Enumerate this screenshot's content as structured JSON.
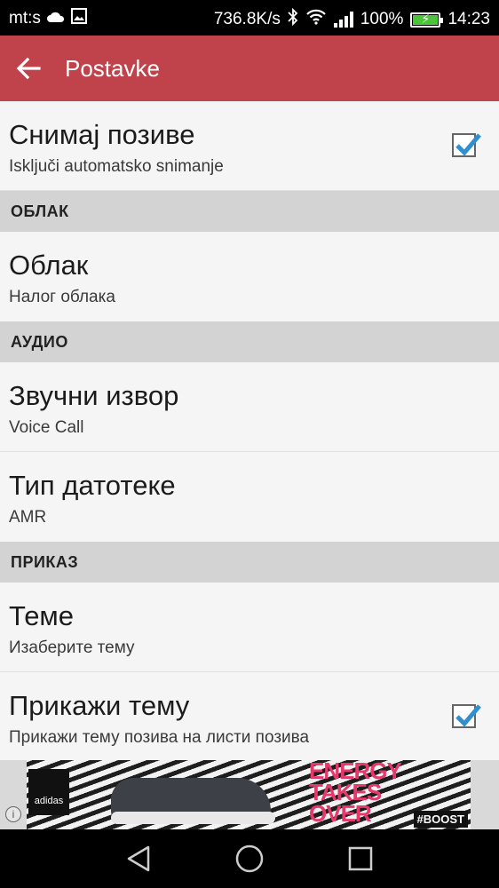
{
  "status_bar": {
    "carrier": "mt:s",
    "net_speed": "736.8K/s",
    "battery": "100%",
    "time": "14:23",
    "icons": [
      "cloud-icon",
      "image-icon",
      "bluetooth-icon",
      "wifi-icon",
      "signal-icon",
      "battery-icon"
    ]
  },
  "app_bar": {
    "title": "Postavke",
    "color": "#c0424b"
  },
  "prefs": {
    "record_calls": {
      "title": "Снимај позиве",
      "summary": "Isključi automatsko snimanje",
      "checked": true
    },
    "cloud_category": "ОБЛАК",
    "cloud": {
      "title": "Облак",
      "summary": "Налог облака"
    },
    "audio_category": "АУДИО",
    "audio_source": {
      "title": "Звучни извор",
      "summary": "Voice Call"
    },
    "file_type": {
      "title": "Тип датотеке",
      "summary": "AMR"
    },
    "display_category": "ПРИКАЗ",
    "themes": {
      "title": "Теме",
      "summary": "Изаберите тему"
    },
    "show_theme": {
      "title": "Прикажи тему",
      "summary": "Прикажи тему позива на листи позива",
      "checked": true
    }
  },
  "ad": {
    "brand": "adidas",
    "headline": "ENERGY TAKES OVER",
    "tag": "#BOOST",
    "info": "i"
  },
  "accent_color": "#2f8fd0"
}
